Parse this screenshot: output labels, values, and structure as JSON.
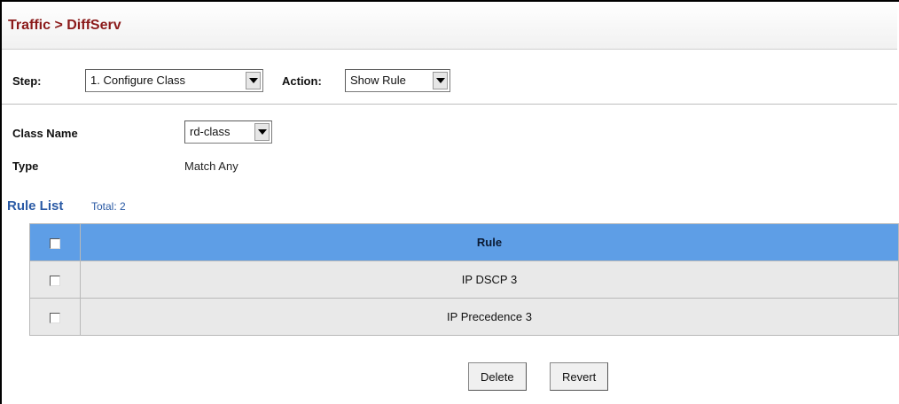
{
  "header": {
    "title": "Traffic > DiffServ"
  },
  "toolbar": {
    "step_label": "Step:",
    "step_value": "1. Configure Class",
    "action_label": "Action:",
    "action_value": "Show Rule"
  },
  "form": {
    "class_name_label": "Class Name",
    "class_name_value": "rd-class",
    "type_label": "Type",
    "type_value": "Match Any"
  },
  "rule_list": {
    "title": "Rule List",
    "total": "Total: 2",
    "header": "Rule",
    "rows": [
      "IP DSCP 3",
      "IP Precedence 3"
    ]
  },
  "buttons": {
    "delete": "Delete",
    "revert": "Revert"
  },
  "colors": {
    "title": "#8b1a1a",
    "link": "#2a5aa5",
    "table_header": "#5e9ee6",
    "row": "#e9e9e9"
  }
}
